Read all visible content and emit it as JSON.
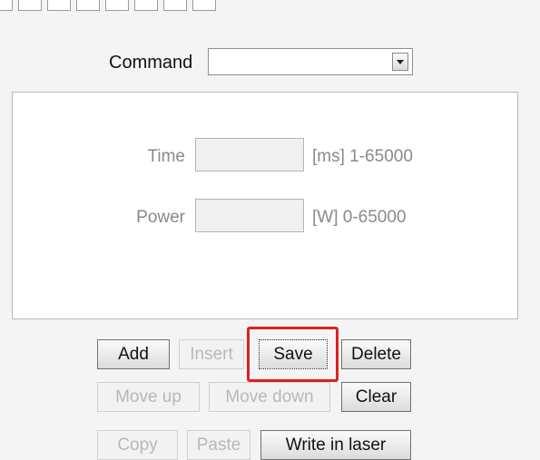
{
  "command": {
    "label": "Command",
    "value": ""
  },
  "fields": {
    "time": {
      "label": "Time",
      "value": "",
      "unit": "[ms] 1-65000"
    },
    "power": {
      "label": "Power",
      "value": "",
      "unit": "[W] 0-65000"
    }
  },
  "buttons": {
    "add": "Add",
    "insert": "Insert",
    "save": "Save",
    "delete": "Delete",
    "move_up": "Move up",
    "move_down": "Move down",
    "clear": "Clear",
    "copy": "Copy",
    "paste": "Paste",
    "write_in_laser": "Write in laser"
  },
  "colors": {
    "highlight": "#e02020"
  }
}
